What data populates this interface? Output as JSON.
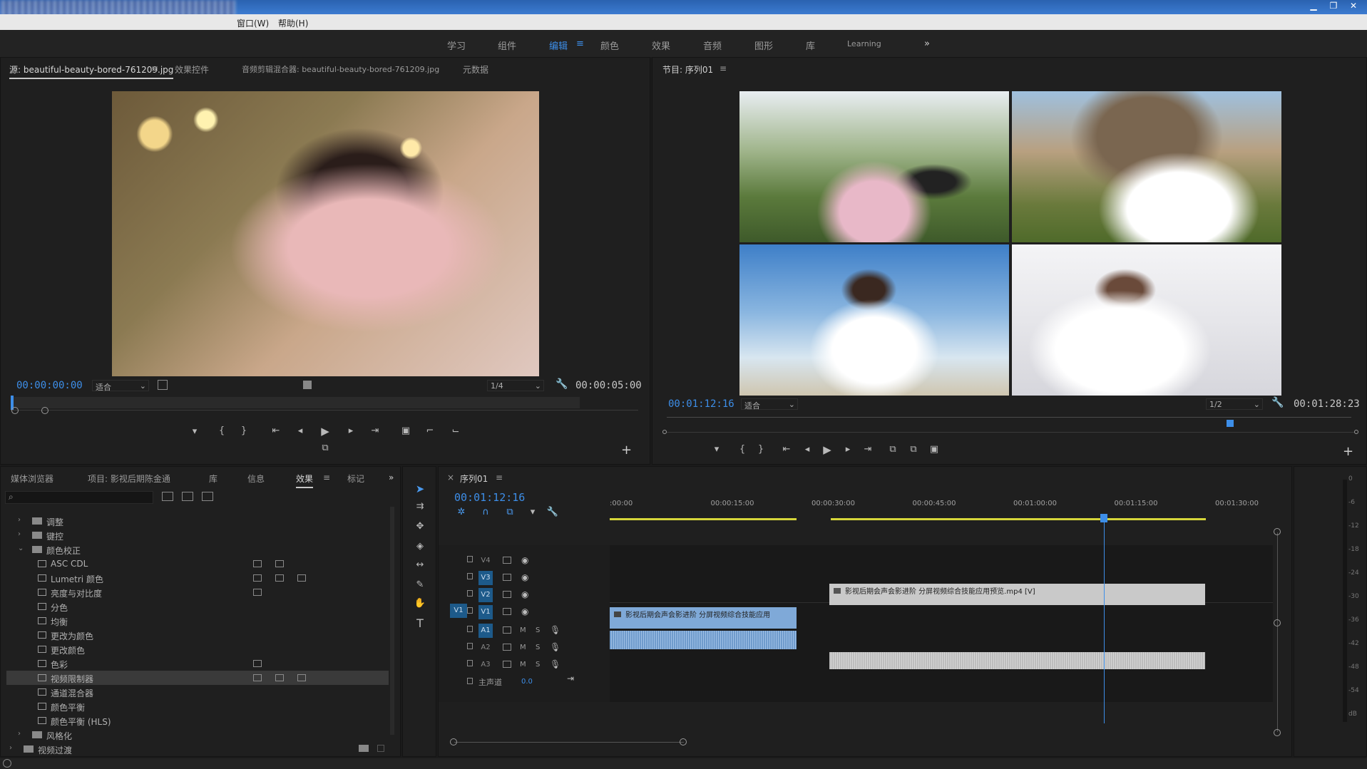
{
  "window": {
    "menu": [
      "窗口(W)",
      "帮助(H)"
    ],
    "buttons": [
      "▁",
      "❐",
      "✕"
    ]
  },
  "workspaces": {
    "items": [
      "学习",
      "组件",
      "编辑",
      "颜色",
      "效果",
      "音频",
      "图形",
      "库",
      "Learning"
    ],
    "active": "编辑",
    "overflow": "»",
    "menu_icon": "≡"
  },
  "source": {
    "tabs": [
      "源: beautiful-beauty-bored-761209.jpg",
      "效果控件",
      "音频剪辑混合器: beautiful-beauty-bored-761209.jpg",
      "元数据"
    ],
    "menu_icon": "≡",
    "timecode": "00:00:00:00",
    "fit": "适合",
    "resolution": "1/4",
    "duration": "00:00:05:00",
    "plus": "+"
  },
  "program": {
    "tab": "节目: 序列01",
    "menu_icon": "≡",
    "timecode": "00:01:12:16",
    "fit": "适合",
    "resolution": "1/2",
    "duration": "00:01:28:23",
    "plus": "+"
  },
  "project": {
    "tabs": [
      "媒体浏览器",
      "项目: 影视后期陈金通",
      "库",
      "信息",
      "效果",
      "标记"
    ],
    "active_tab": "效果",
    "menu_icon": "≡",
    "overflow": "»",
    "search_placeholder": "",
    "search_icon": "⌕",
    "rows": [
      {
        "label": "调整",
        "level": 1,
        "type": "folder",
        "twirl": "›"
      },
      {
        "label": "键控",
        "level": 1,
        "type": "folder",
        "twirl": "›"
      },
      {
        "label": "颜色校正",
        "level": 1,
        "type": "folder",
        "twirl": "⌄"
      },
      {
        "label": "ASC CDL",
        "level": 2,
        "type": "effect",
        "badges": 2
      },
      {
        "label": "Lumetri 颜色",
        "level": 2,
        "type": "effect",
        "badges": 3
      },
      {
        "label": "亮度与对比度",
        "level": 2,
        "type": "effect",
        "badges": 1
      },
      {
        "label": "分色",
        "level": 2,
        "type": "effect",
        "badges": 0
      },
      {
        "label": "均衡",
        "level": 2,
        "type": "effect",
        "badges": 0
      },
      {
        "label": "更改为颜色",
        "level": 2,
        "type": "effect",
        "badges": 0
      },
      {
        "label": "更改颜色",
        "level": 2,
        "type": "effect",
        "badges": 0
      },
      {
        "label": "色彩",
        "level": 2,
        "type": "effect",
        "badges": 1
      },
      {
        "label": "视频限制器",
        "level": 2,
        "type": "effect",
        "badges": 3,
        "selected": true
      },
      {
        "label": "通道混合器",
        "level": 2,
        "type": "effect",
        "badges": 0
      },
      {
        "label": "颜色平衡",
        "level": 2,
        "type": "effect",
        "badges": 0
      },
      {
        "label": "颜色平衡 (HLS)",
        "level": 2,
        "type": "effect",
        "badges": 0
      },
      {
        "label": "风格化",
        "level": 1,
        "type": "folder",
        "twirl": "›"
      },
      {
        "label": "视频过渡",
        "level": 0,
        "type": "folder",
        "twirl": "›"
      }
    ]
  },
  "timeline": {
    "tab": "序列01",
    "close": "×",
    "menu_icon": "≡",
    "timecode": "00:01:12:16",
    "ruler": [
      ":00:00",
      "00:00:15:00",
      "00:00:30:00",
      "00:00:45:00",
      "00:01:00:00",
      "00:01:15:00",
      "00:01:30:00"
    ],
    "playhead_fraction": 0.745,
    "video_tracks": [
      "V4",
      "V3",
      "V2",
      "V1"
    ],
    "audio_tracks": [
      "A1",
      "A2",
      "A3"
    ],
    "master": {
      "label": "主声道",
      "value": "0.0"
    },
    "track_buttons": {
      "mute": "M",
      "solo": "S"
    },
    "clips": {
      "v2": "影视后期会声会影进阶 分屏视频综合技能应用预览.mp4 [V]",
      "v1": "影视后期会声会影进阶 分屏视频综合技能应用"
    }
  },
  "meter": {
    "labels": [
      "0",
      "-6",
      "-12",
      "-18",
      "-24",
      "-30",
      "-36",
      "-42",
      "-48",
      "-54",
      "dB"
    ]
  },
  "colors": {
    "accent": "#3d8ee8",
    "clip_blue": "#7fa9d8",
    "clip_grey": "#c9c9c9",
    "render_yellow": "#d6d63a"
  }
}
